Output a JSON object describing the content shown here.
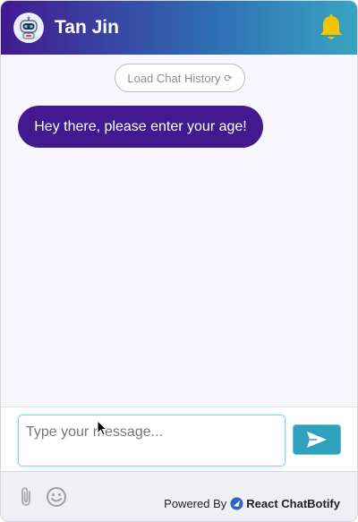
{
  "header": {
    "title": "Tan Jin",
    "avatar_icon": "robot-avatar-icon",
    "notification_icon": "bell-icon",
    "gradient_colors": [
      "#42198f",
      "#2f6fb4",
      "#39a4c2"
    ],
    "bell_color": "#f5c400"
  },
  "chat": {
    "load_history_label": "Load Chat History",
    "load_history_icon": "refresh-icon",
    "messages": [
      {
        "sender": "bot",
        "text": "Hey there, please enter your age!"
      }
    ],
    "bot_bubble_color": "#42198f"
  },
  "composer": {
    "placeholder": "Type your message...",
    "value": "",
    "send_icon": "send-icon",
    "send_color": "#2fa0bd"
  },
  "footer": {
    "attach_icon": "paperclip-icon",
    "emoji_icon": "emoji-icon",
    "powered_by_label": "Powered By",
    "brand_name": "React ChatBotify",
    "brand_icon": "chatbotify-logo-icon"
  }
}
